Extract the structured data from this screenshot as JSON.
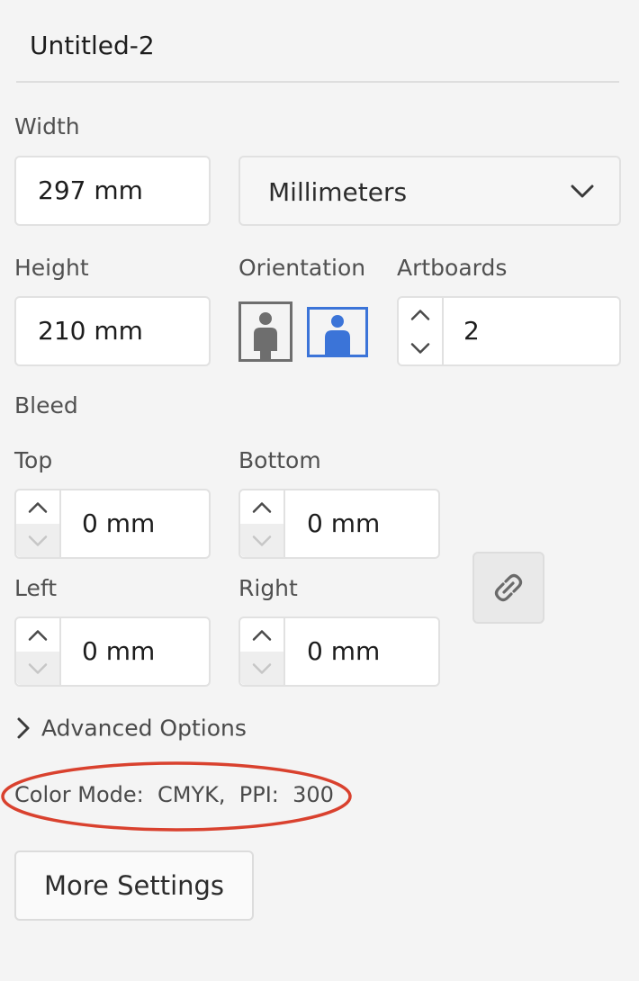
{
  "document": {
    "name": "Untitled-2"
  },
  "size": {
    "width_label": "Width",
    "width_value": "297 mm",
    "units_value": "Millimeters",
    "height_label": "Height",
    "height_value": "210 mm"
  },
  "orientation": {
    "label": "Orientation",
    "options": [
      "portrait",
      "landscape"
    ],
    "selected": "landscape"
  },
  "artboards": {
    "label": "Artboards",
    "value": "2"
  },
  "bleed": {
    "label": "Bleed",
    "top_label": "Top",
    "top_value": "0 mm",
    "bottom_label": "Bottom",
    "bottom_value": "0 mm",
    "left_label": "Left",
    "left_value": "0 mm",
    "right_label": "Right",
    "right_value": "0 mm",
    "link_icon": "link-icon"
  },
  "advanced": {
    "label": "Advanced Options",
    "expanded": false
  },
  "color_mode": {
    "text": "Color Mode:  CMYK,  PPI:  300",
    "highlight_color": "#d9412e"
  },
  "buttons": {
    "more_settings": "More Settings"
  },
  "colors": {
    "accent": "#3b74d8",
    "panel_bg": "#f4f4f4"
  }
}
